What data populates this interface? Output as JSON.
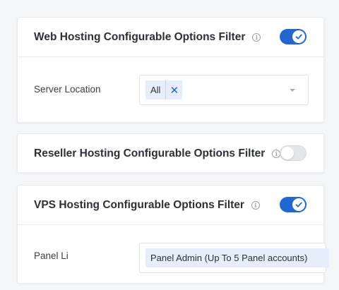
{
  "cards": [
    {
      "title": "Web Hosting Configurable Options Filter",
      "toggle_on": true,
      "field": {
        "label": "Server Location",
        "chip": "All"
      }
    },
    {
      "title": "Reseller Hosting Configurable Options Filter",
      "toggle_on": false
    },
    {
      "title": "VPS Hosting Configurable Options Filter",
      "toggle_on": true,
      "field": {
        "label": "Panel Li",
        "chip": "Panel Admin (Up To 5 Panel accounts)"
      }
    }
  ],
  "colors": {
    "accent": "#2366d1",
    "chip_bg": "#e6eefb",
    "toggle_off": "#e4e6ea"
  },
  "icons": {
    "info": "info-icon",
    "check": "check-icon",
    "remove": "close-icon",
    "caret": "chevron-down-icon"
  }
}
